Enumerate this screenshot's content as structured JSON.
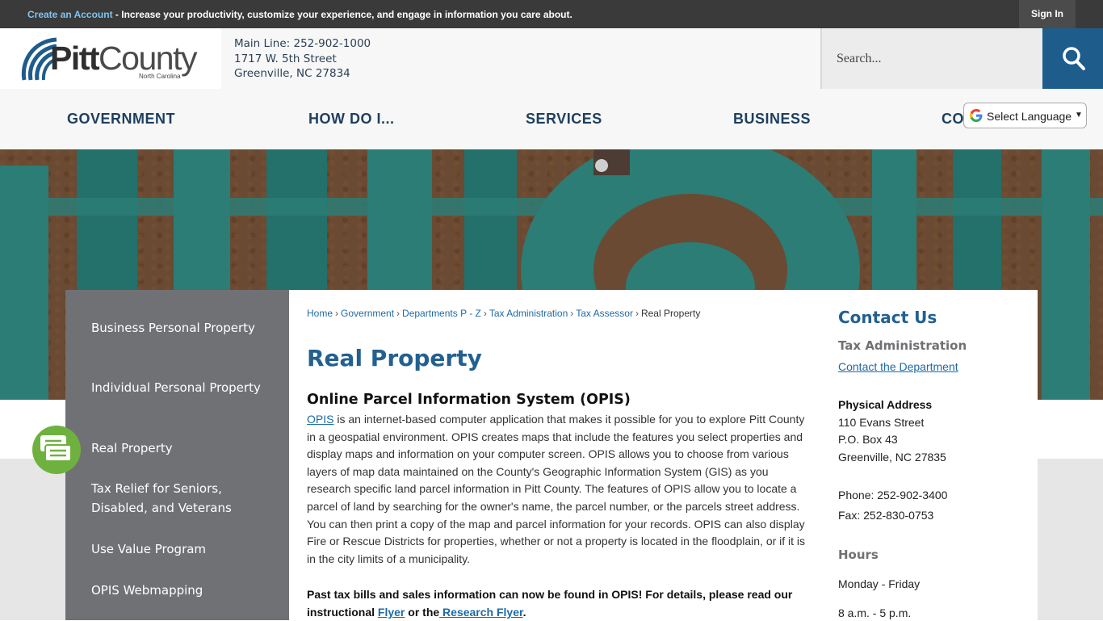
{
  "topbar": {
    "create_label": "Create an Account",
    "message": " - Increase your productivity, customize your experience, and engage in information you care about.",
    "signin_label": "Sign In"
  },
  "header": {
    "logo_main_bold": "Pitt",
    "logo_main": "County",
    "logo_sub": "North Carolina",
    "main_line": "Main Line: 252-902-1000",
    "street": "1717 W. 5th Street",
    "city": "Greenville, NC 27834",
    "search_placeholder": "Search..."
  },
  "nav": {
    "items": [
      "GOVERNMENT",
      "HOW DO I...",
      "SERVICES",
      "BUSINESS",
      "CO"
    ],
    "language_label": "Select Language"
  },
  "sidebar": {
    "items": [
      "Business Personal Property",
      "Individual Personal Property",
      "Real Property",
      "Tax Relief for Seniors, Disabled, and Veterans",
      "Use Value Program",
      "OPIS Webmapping"
    ]
  },
  "breadcrumb": {
    "links": [
      "Home",
      "Government",
      "Departments P - Z",
      "Tax Administration",
      "Tax Assessor"
    ],
    "current": "Real Property",
    "separator": "›"
  },
  "main": {
    "title": "Real Property",
    "subtitle": "Online Parcel Information System (OPIS)",
    "opis_link": "OPIS",
    "paragraph": " is an internet-based computer application that makes it possible for you to explore Pitt County in a geospatial environment. OPIS creates maps that include the features you select properties and display maps and information on your computer screen. OPIS allows you to choose from various layers of map data maintained on the County's Geographic Information System (GIS) as you research specific land parcel information in Pitt County. The features of OPIS allow you to locate a parcel of land by searching for the owner's name, the parcel number, or the parcels street address. You can then print a copy of the map and parcel information for your records. OPIS can also display Fire or Rescue Districts for properties, whether or not a property is located in the floodplain, or if it is in the city limits of a municipality.",
    "note_text": "Past tax bills and sales information can now be found in OPIS! For details, please read our instructional ",
    "flyer_link": "Flyer",
    "note_mid": " or the",
    "research_link": " Research Flyer",
    "note_end": "."
  },
  "contact": {
    "title": "Contact Us",
    "department": "Tax Administration",
    "dept_link": "Contact the Department",
    "address_label": "Physical Address",
    "address_1": "110 Evans Street",
    "address_2": "P.O. Box 43",
    "address_3": "Greenville, NC 27835",
    "phone": "Phone: 252-902-3400",
    "fax": "Fax: 252-830-0753",
    "hours_label": "Hours",
    "days": "Monday - Friday",
    "times": "8 a.m. - 5 p.m."
  },
  "colors": {
    "accent_blue": "#23608f",
    "nav_text": "#1d3f5e",
    "sidebar_bg": "#707174",
    "search_button": "#1e5c8c",
    "chat_green": "#6fb13e"
  }
}
